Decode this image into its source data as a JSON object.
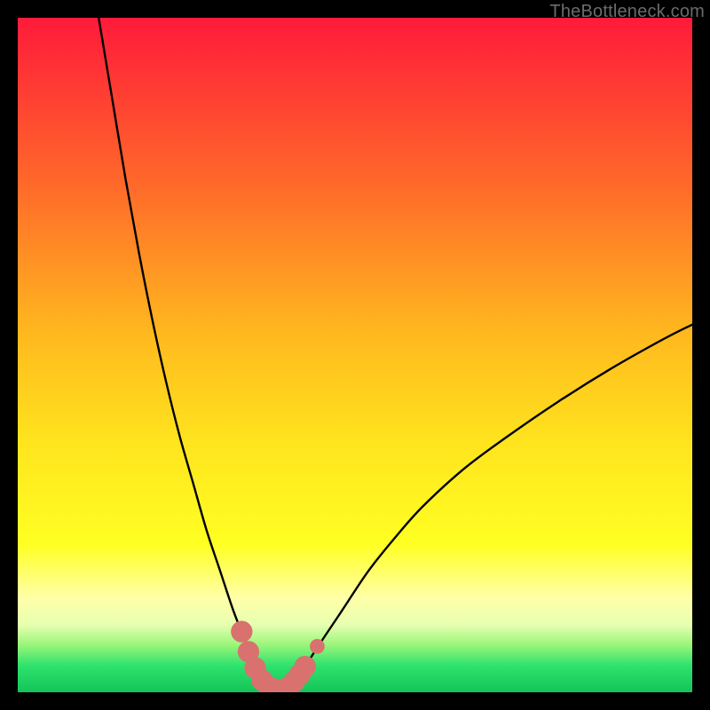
{
  "watermark": "TheBottleneck.com",
  "colors": {
    "bg_black": "#000000",
    "grad_top": "#ff1a3a",
    "grad_mid1": "#ff6a2a",
    "grad_mid2": "#ffd21e",
    "grad_yellow": "#ffff22",
    "grad_pale": "#ffffa8",
    "grad_green1": "#9af57a",
    "grad_green2": "#2fe36e",
    "grad_green3": "#13c558",
    "curve": "#000000",
    "marker_fill": "#d9716f",
    "marker_stroke": "#d9716f"
  },
  "chart_data": {
    "type": "line",
    "title": "",
    "xlabel": "",
    "ylabel": "",
    "xlim": [
      0,
      100
    ],
    "ylim": [
      0,
      100
    ],
    "description": "Bottleneck percentage vs component scaling. V-shaped curve with minimum around x≈36–40 (bottleneck ≈ 0%). Left branch rises steeply toward ~100% as x→~12; right branch rises toward ~55% as x→100.",
    "series": [
      {
        "name": "bottleneck-curve",
        "x": [
          12,
          14,
          16,
          18,
          20,
          22,
          24,
          26,
          28,
          30,
          32,
          34,
          35.5,
          37,
          38,
          39,
          40,
          41,
          42,
          44,
          48,
          52,
          56,
          60,
          66,
          72,
          80,
          88,
          96,
          100
        ],
        "y": [
          100,
          88,
          76,
          65,
          55,
          46,
          38,
          31,
          24,
          18,
          12,
          7,
          3.5,
          1.2,
          0.4,
          0.2,
          0.4,
          1.2,
          2.7,
          6,
          12,
          18,
          23,
          27.5,
          33,
          37.5,
          43,
          48,
          52.5,
          54.5
        ]
      }
    ],
    "markers": {
      "name": "highlight-dots",
      "x": [
        33.2,
        34.2,
        35.2,
        36.2,
        37.2,
        38.2,
        39.2,
        40.2,
        41.0,
        41.8,
        42.6,
        44.4
      ],
      "y": [
        9.0,
        6.0,
        3.6,
        1.8,
        0.8,
        0.4,
        0.4,
        0.8,
        1.6,
        2.6,
        3.8,
        6.8
      ],
      "r": [
        1.6,
        1.6,
        1.6,
        1.6,
        1.6,
        1.6,
        1.6,
        1.6,
        1.6,
        1.6,
        1.6,
        1.1
      ]
    },
    "gradient_stops_pct": [
      0,
      25,
      47,
      63,
      78,
      86,
      90,
      93,
      96,
      100
    ]
  }
}
